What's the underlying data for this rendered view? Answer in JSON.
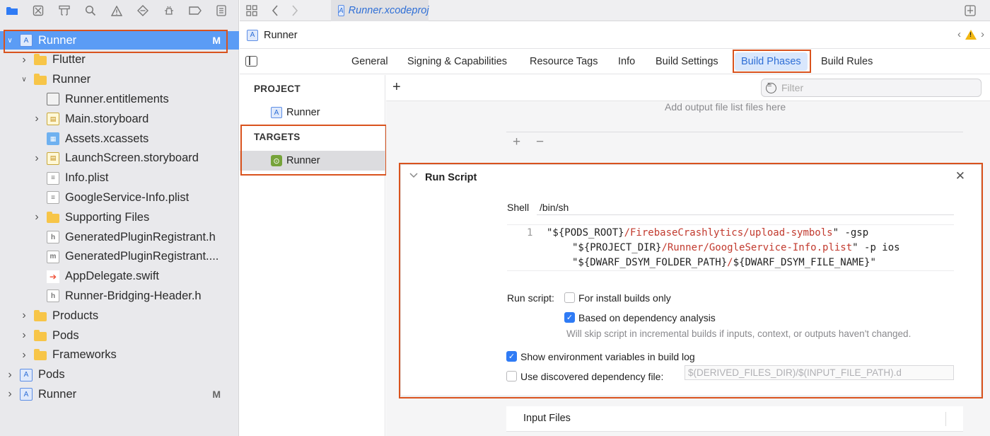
{
  "colors": {
    "accent": "#2f7bf5",
    "highlight": "#d9531e",
    "selection": "#5b9cf5",
    "folder": "#f7c548"
  },
  "navigator": {
    "toolbar_icons": [
      "folder-icon",
      "source-control-icon",
      "hierarchy-icon",
      "search-icon",
      "warning-icon",
      "test-icon",
      "debug-icon",
      "breakpoint-icon",
      "report-icon"
    ],
    "tree": [
      {
        "label": "Runner",
        "badge": "M",
        "depth": 0,
        "icon": "project",
        "disclosure": "open",
        "selected": true
      },
      {
        "label": "Flutter",
        "depth": 1,
        "icon": "folder",
        "disclosure": "closed"
      },
      {
        "label": "Runner",
        "depth": 1,
        "icon": "folder",
        "disclosure": "open"
      },
      {
        "label": "Runner.entitlements",
        "depth": 2,
        "icon": "entitlements",
        "disclosure": "none"
      },
      {
        "label": "Main.storyboard",
        "depth": 2,
        "icon": "storyboard",
        "disclosure": "closed"
      },
      {
        "label": "Assets.xcassets",
        "depth": 2,
        "icon": "assets",
        "disclosure": "none"
      },
      {
        "label": "LaunchScreen.storyboard",
        "depth": 2,
        "icon": "storyboard",
        "disclosure": "closed"
      },
      {
        "label": "Info.plist",
        "depth": 2,
        "icon": "plist",
        "disclosure": "none"
      },
      {
        "label": "GoogleService-Info.plist",
        "depth": 2,
        "icon": "plist",
        "disclosure": "none"
      },
      {
        "label": "Supporting Files",
        "depth": 2,
        "icon": "folder",
        "disclosure": "closed"
      },
      {
        "label": "GeneratedPluginRegistrant.h",
        "depth": 2,
        "icon": "header",
        "disclosure": "none"
      },
      {
        "label": "GeneratedPluginRegistrant....",
        "depth": 2,
        "icon": "objc",
        "disclosure": "none"
      },
      {
        "label": "AppDelegate.swift",
        "depth": 2,
        "icon": "swift",
        "disclosure": "none"
      },
      {
        "label": "Runner-Bridging-Header.h",
        "depth": 2,
        "icon": "header",
        "disclosure": "none"
      },
      {
        "label": "Products",
        "depth": 1,
        "icon": "folder",
        "disclosure": "closed"
      },
      {
        "label": "Pods",
        "depth": 1,
        "icon": "folder",
        "disclosure": "closed"
      },
      {
        "label": "Frameworks",
        "depth": 1,
        "icon": "folder",
        "disclosure": "closed"
      },
      {
        "label": "Pods",
        "depth": 0,
        "icon": "project",
        "disclosure": "closed"
      },
      {
        "label": "Runner",
        "badge": "M",
        "depth": 0,
        "icon": "project",
        "disclosure": "closed"
      }
    ]
  },
  "tab_bar": {
    "file_tab": "Runner.xcodeproj"
  },
  "jump_bar": {
    "path": "Runner"
  },
  "settings_tabs": [
    "General",
    "Signing & Capabilities",
    "Resource Tags",
    "Info",
    "Build Settings",
    "Build Phases",
    "Build Rules"
  ],
  "targets_column": {
    "project_header": "PROJECT",
    "project_item": "Runner",
    "targets_header": "TARGETS",
    "target_item": "Runner"
  },
  "phases": {
    "filter_placeholder": "Filter",
    "add_button": "+",
    "output_hint": "Add output file list files here",
    "plus": "+",
    "minus": "−",
    "run_script": {
      "title": "Run Script",
      "shell_label": "Shell",
      "shell_value": "/bin/sh",
      "line_number": "1",
      "script": {
        "l1a": "\"${PODS_ROOT}",
        "l1b": "/FirebaseCrashlytics/upload-symbols",
        "l1c": "\" -gsp",
        "l2a": "\"${PROJECT_DIR}",
        "l2b": "/Runner/GoogleService-Info.plist",
        "l2c": "\" -p ios",
        "l3a": "\"${DWARF_DSYM_FOLDER_PATH}",
        "l3b": "/",
        "l3c": "${DWARF_DSYM_FILE_NAME}\""
      },
      "run_script_label": "Run script:",
      "install_only": {
        "label": "For install builds only",
        "checked": false
      },
      "dependency_analysis": {
        "label": "Based on dependency analysis",
        "checked": true
      },
      "hint": "Will skip script in incremental builds if inputs, context, or outputs haven't changed.",
      "show_env": {
        "label": "Show environment variables in build log",
        "checked": true
      },
      "discovered_dep": {
        "label": "Use discovered dependency file:",
        "checked": false,
        "placeholder": "$(DERIVED_FILES_DIR)/$(INPUT_FILE_PATH).d"
      }
    },
    "input_files": "Input Files"
  }
}
